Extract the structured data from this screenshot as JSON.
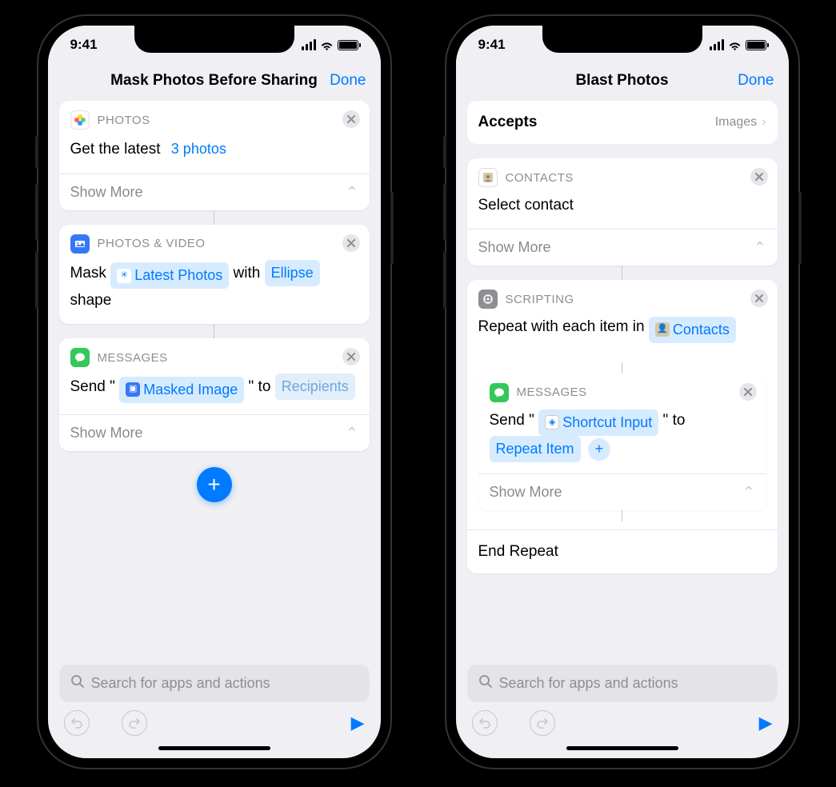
{
  "shared": {
    "time": "9:41",
    "done": "Done",
    "show_more": "Show More",
    "search_placeholder": "Search for apps and actions"
  },
  "left": {
    "title": "Mask Photos Before Sharing",
    "action1": {
      "category": "PHOTOS",
      "text_a": "Get the latest",
      "pill": "3 photos"
    },
    "action2": {
      "category": "PHOTOS & VIDEO",
      "text_a": "Mask",
      "pill_a": "Latest Photos",
      "text_b": "with",
      "pill_b": "Ellipse",
      "text_c": "shape"
    },
    "action3": {
      "category": "MESSAGES",
      "text_a": "Send \"",
      "pill_a": "Masked Image",
      "text_b": "\" to",
      "pill_b": "Recipients"
    }
  },
  "right": {
    "title": "Blast Photos",
    "accepts_label": "Accepts",
    "accepts_value": "Images",
    "action1": {
      "category": "CONTACTS",
      "text_a": "Select contact"
    },
    "action2": {
      "category": "SCRIPTING",
      "text_a": "Repeat with each item in",
      "pill_a": "Contacts",
      "end": "End Repeat"
    },
    "action3": {
      "category": "MESSAGES",
      "text_a": "Send \"",
      "pill_a": "Shortcut Input",
      "text_b": "\" to",
      "pill_b": "Repeat Item"
    }
  }
}
